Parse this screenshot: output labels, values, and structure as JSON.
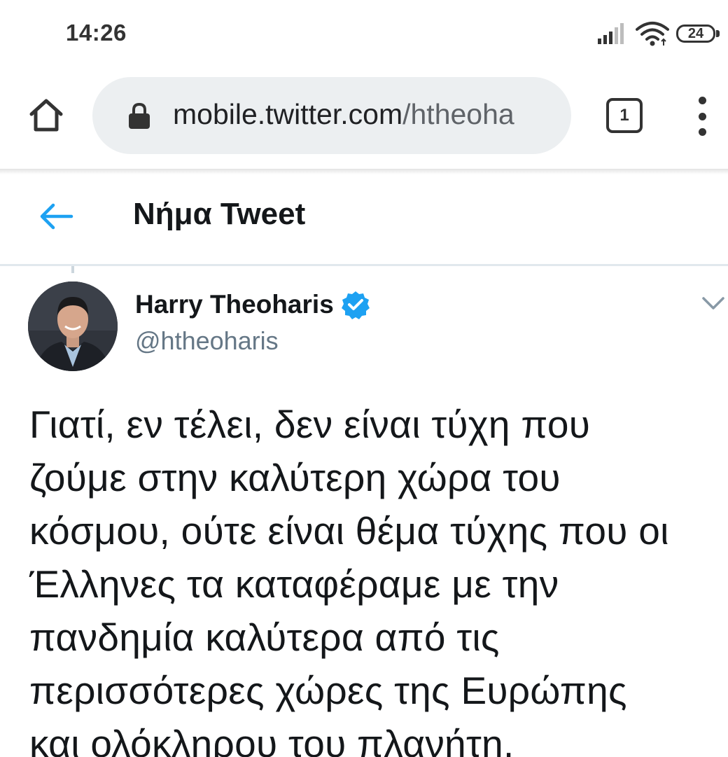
{
  "status_bar": {
    "time": "14:26",
    "battery": "24"
  },
  "browser": {
    "url_host": "mobile.twitter.com",
    "url_path": "/htheoha",
    "tab_count": "1"
  },
  "header": {
    "title": "Νήμα Tweet"
  },
  "tweet": {
    "author_name": "Harry Theoharis",
    "author_handle": "@htheoharis",
    "verified": true,
    "lines": [
      "Γιατί, εν τέλει, δεν είναι τύχη που",
      "ζούμε στην καλύτερη χώρα του",
      "κόσμου, ούτε είναι θέμα τύχης που οι",
      "Έλληνες τα καταφέραμε με την",
      "πανδημία καλύτερα από τις",
      "περισσότερες χώρες της Ευρώπης",
      "και ολόκληρου του πλανήτη."
    ]
  },
  "colors": {
    "twitter_blue": "#1da1f2",
    "url_pill": "#eceff1",
    "handle_gray": "#657786",
    "divider": "#e1e8ed"
  },
  "icons": [
    "signal-icon",
    "wifi-icon",
    "battery-icon",
    "home-icon",
    "lock-icon",
    "tabs-icon",
    "more-vert-icon",
    "back-arrow-icon",
    "verified-icon",
    "chevron-down-icon"
  ]
}
